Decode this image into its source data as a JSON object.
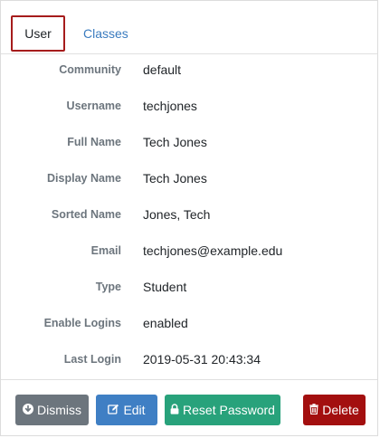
{
  "tabs": [
    {
      "label": "User",
      "active": true
    },
    {
      "label": "Classes",
      "active": false
    }
  ],
  "details": [
    {
      "label": "Community",
      "value": "default"
    },
    {
      "label": "Username",
      "value": "techjones"
    },
    {
      "label": "Full Name",
      "value": "Tech Jones"
    },
    {
      "label": "Display Name",
      "value": "Tech Jones"
    },
    {
      "label": "Sorted Name",
      "value": "Jones, Tech"
    },
    {
      "label": "Email",
      "value": "techjones@example.edu"
    },
    {
      "label": "Type",
      "value": "Student"
    },
    {
      "label": "Enable Logins",
      "value": "enabled"
    },
    {
      "label": "Last Login",
      "value": "2019-05-31 20:43:34"
    }
  ],
  "actions": {
    "dismiss": {
      "label": "Dismiss",
      "icon": "arrow-circle-down-icon"
    },
    "edit": {
      "label": "Edit",
      "icon": "edit-icon"
    },
    "reset_password": {
      "label": "Reset Password",
      "icon": "lock-icon"
    },
    "delete": {
      "label": "Delete",
      "icon": "trash-icon"
    }
  },
  "colors": {
    "active_tab_border": "#a61c1c",
    "link_tab": "#3a7bbf",
    "label_text": "#6c757d",
    "dismiss_bg": "#6c757d",
    "edit_bg": "#3f7fc4",
    "reset_bg": "#28a27b",
    "delete_bg": "#a30f0f"
  }
}
